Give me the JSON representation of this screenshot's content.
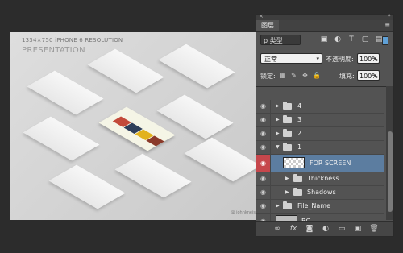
{
  "canvas": {
    "resolution_text": "1334×750  iPHONE 6 RESOLUTION",
    "subtitle": "PRESENTATION",
    "credit": "@ johnkneis",
    "background": "#d2d2d2"
  },
  "panel": {
    "tab_label": "图层",
    "menu_icon": "menu-icon",
    "filter": {
      "kind_label": "ρ 类型",
      "icons": [
        "image-filter-icon",
        "adjustment-filter-icon",
        "type-filter-icon",
        "shape-filter-icon",
        "smart-object-filter-icon"
      ],
      "icon_glyphs": [
        "▣",
        "◐",
        "T",
        "▢",
        "▤"
      ]
    },
    "blend_mode": "正常",
    "opacity_label": "不透明度:",
    "opacity_value": "100%",
    "lock_label": "锁定:",
    "fill_label": "填充:",
    "fill_value": "100%",
    "lock_glyphs": [
      "▦",
      "✎",
      "✥",
      "🔒"
    ]
  },
  "layers": [
    {
      "name": "4",
      "type": "folder",
      "expanded": false,
      "visible": true
    },
    {
      "name": "3",
      "type": "folder",
      "expanded": false,
      "visible": true
    },
    {
      "name": "2",
      "type": "folder",
      "expanded": false,
      "visible": true
    },
    {
      "name": "1",
      "type": "folder",
      "expanded": true,
      "visible": true
    },
    {
      "name": "FOR SCREEN",
      "type": "smart-object",
      "selected": true,
      "visible": true
    },
    {
      "name": "Thickness",
      "type": "folder",
      "expanded": false,
      "visible": true
    },
    {
      "name": "Shadows",
      "type": "folder",
      "expanded": false,
      "visible": true
    },
    {
      "name": "File_Name",
      "type": "folder",
      "expanded": false,
      "visible": true
    },
    {
      "name": "BG",
      "type": "layer",
      "visible": true
    }
  ],
  "bottom_bar": {
    "icons": [
      "link-layers-icon",
      "fx-icon",
      "add-mask-icon",
      "adjustment-layer-icon",
      "new-group-icon",
      "new-layer-icon",
      "delete-layer-icon"
    ],
    "glyphs": [
      "∞",
      "fx",
      "◙",
      "◐",
      "▭",
      "▣",
      "🗑"
    ]
  },
  "colors": {
    "selected_row": "#5c7da0",
    "eye_highlight": "#c6474c",
    "panel_bg": "#535353"
  }
}
